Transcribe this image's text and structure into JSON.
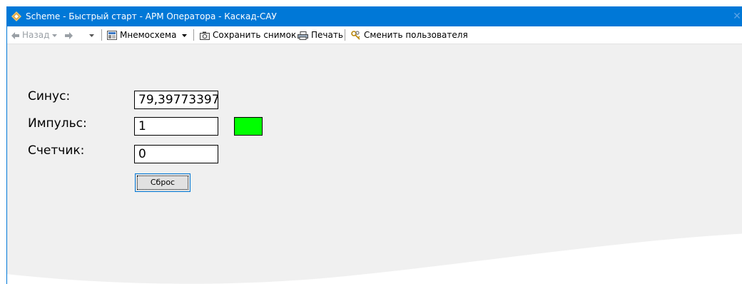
{
  "window": {
    "title": "Scheme - Быстрый старт - АРМ Оператора - Каскад-САУ",
    "close_glyph": "✕",
    "accent_color": "#0078d7"
  },
  "toolbar": {
    "back_label": "Назад",
    "mnemo_label": "Мнемосхема",
    "snapshot_label": "Сохранить снимок",
    "print_label": "Печать",
    "switch_user_label": "Сменить пользователя"
  },
  "fields": {
    "sinus": {
      "label": "Синус:",
      "value": "79,39773397"
    },
    "impulse": {
      "label": "Импульс:",
      "value": "1",
      "indicator_color": "#00ff00"
    },
    "counter": {
      "label": "Счетчик:",
      "value": "0"
    }
  },
  "reset_button": {
    "label": "Сброс"
  }
}
